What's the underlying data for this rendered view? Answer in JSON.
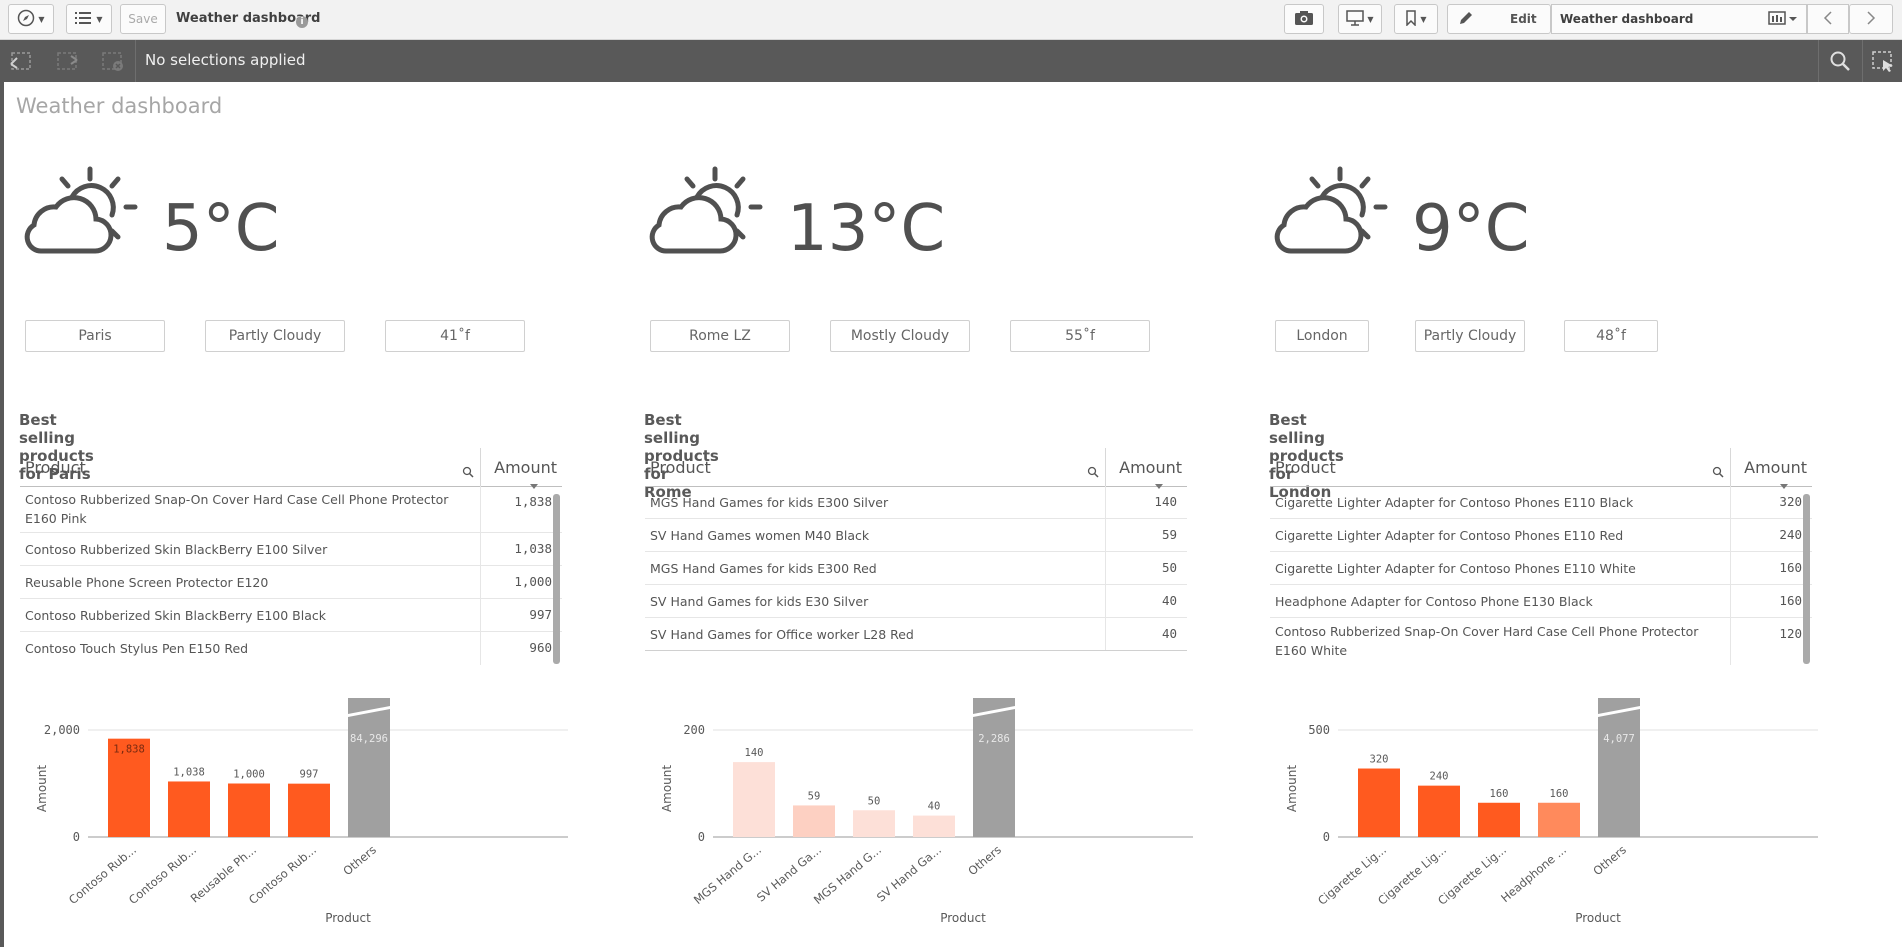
{
  "toolbar": {
    "save_label": "Save",
    "app_title": "Weather dashboard",
    "edit_label": "Edit",
    "sheet_selector_label": "Weather dashboard"
  },
  "selections": {
    "status": "No selections applied"
  },
  "sheet": {
    "title": "Weather dashboard"
  },
  "cities": [
    {
      "temp_c": "5°C",
      "city": "Paris",
      "condition": "Partly Cloudy",
      "temp_f": "41˚f",
      "table_title": "Best selling products for Paris",
      "col_product": "Product",
      "col_amount": "Amount",
      "rows": [
        {
          "product": "Contoso Rubberized Snap-On Cover Hard Case Cell Phone Protector E160 Pink",
          "amount": "1,838"
        },
        {
          "product": "Contoso Rubberized Skin BlackBerry E100 Silver",
          "amount": "1,038"
        },
        {
          "product": "Reusable Phone Screen Protector E120",
          "amount": "1,000"
        },
        {
          "product": "Contoso Rubberized Skin BlackBerry E100 Black",
          "amount": "997"
        },
        {
          "product": "Contoso Touch Stylus Pen E150 Red",
          "amount": "960"
        }
      ]
    },
    {
      "temp_c": "13°C",
      "city": "Rome LZ",
      "condition": "Mostly Cloudy",
      "temp_f": "55˚f",
      "table_title": "Best selling products for Rome",
      "col_product": "Product",
      "col_amount": "Amount",
      "rows": [
        {
          "product": "MGS Hand Games for kids E300 Silver",
          "amount": "140"
        },
        {
          "product": "SV Hand Games women M40 Black",
          "amount": "59"
        },
        {
          "product": "MGS Hand Games for kids E300 Red",
          "amount": "50"
        },
        {
          "product": "SV Hand Games for kids E30 Silver",
          "amount": "40"
        },
        {
          "product": "SV Hand Games for Office worker L28 Red",
          "amount": "40"
        }
      ]
    },
    {
      "temp_c": "9°C",
      "city": "London",
      "condition": "Partly Cloudy",
      "temp_f": "48˚f",
      "table_title": "Best selling products for London",
      "col_product": "Product",
      "col_amount": "Amount",
      "rows": [
        {
          "product": "Cigarette Lighter Adapter for Contoso Phones E110 Black",
          "amount": "320"
        },
        {
          "product": "Cigarette Lighter Adapter for Contoso Phones E110 Red",
          "amount": "240"
        },
        {
          "product": "Cigarette Lighter Adapter for Contoso Phones E110 White",
          "amount": "160"
        },
        {
          "product": "Headphone Adapter for Contoso Phone E130 Black",
          "amount": "160"
        },
        {
          "product": "Contoso Rubberized Snap-On Cover Hard Case Cell Phone Protector E160 White",
          "amount": "120"
        }
      ]
    }
  ],
  "chart_data": [
    {
      "type": "bar",
      "xlabel": "Product",
      "ylabel": "Amount",
      "categories": [
        "Contoso Rub...",
        "Contoso Rub...",
        "Reusable Ph...",
        "Contoso Rub...",
        "Others"
      ],
      "values": [
        1838,
        1038,
        1000,
        997,
        84296
      ],
      "value_labels": [
        "1,838",
        "1,038",
        "1,000",
        "997",
        "84,296"
      ],
      "yticks": [
        0,
        2000
      ],
      "ytick_labels": [
        "0",
        "2,000"
      ],
      "ylim": [
        0,
        2000
      ],
      "colors": [
        "#ff5a1f",
        "#ff5a1f",
        "#ff5a1f",
        "#ff5a1f",
        "#a0a0a0"
      ],
      "others_truncated": true
    },
    {
      "type": "bar",
      "xlabel": "Product",
      "ylabel": "Amount",
      "categories": [
        "MGS Hand G...",
        "SV Hand Ga...",
        "MGS Hand G...",
        "SV Hand Ga...",
        "Others"
      ],
      "values": [
        140,
        59,
        50,
        40,
        2286
      ],
      "value_labels": [
        "140",
        "59",
        "50",
        "40",
        "2,286"
      ],
      "yticks": [
        0,
        200
      ],
      "ytick_labels": [
        "0",
        "200"
      ],
      "ylim": [
        0,
        200
      ],
      "colors": [
        "#fde0d8",
        "#fdd0c2",
        "#fde0d8",
        "#fde0d8",
        "#a0a0a0"
      ],
      "others_truncated": true
    },
    {
      "type": "bar",
      "xlabel": "Product",
      "ylabel": "Amount",
      "categories": [
        "Cigarette Lig...",
        "Cigarette Lig...",
        "Cigarette Lig...",
        "Headphone ...",
        "Others"
      ],
      "values": [
        320,
        240,
        160,
        160,
        4077
      ],
      "value_labels": [
        "320",
        "240",
        "160",
        "160",
        "4,077"
      ],
      "yticks": [
        0,
        500
      ],
      "ytick_labels": [
        "0",
        "500"
      ],
      "ylim": [
        0,
        500
      ],
      "colors": [
        "#ff5a1f",
        "#ff5a1f",
        "#ff5a1f",
        "#ff8a5c",
        "#a0a0a0"
      ],
      "others_truncated": true
    }
  ]
}
